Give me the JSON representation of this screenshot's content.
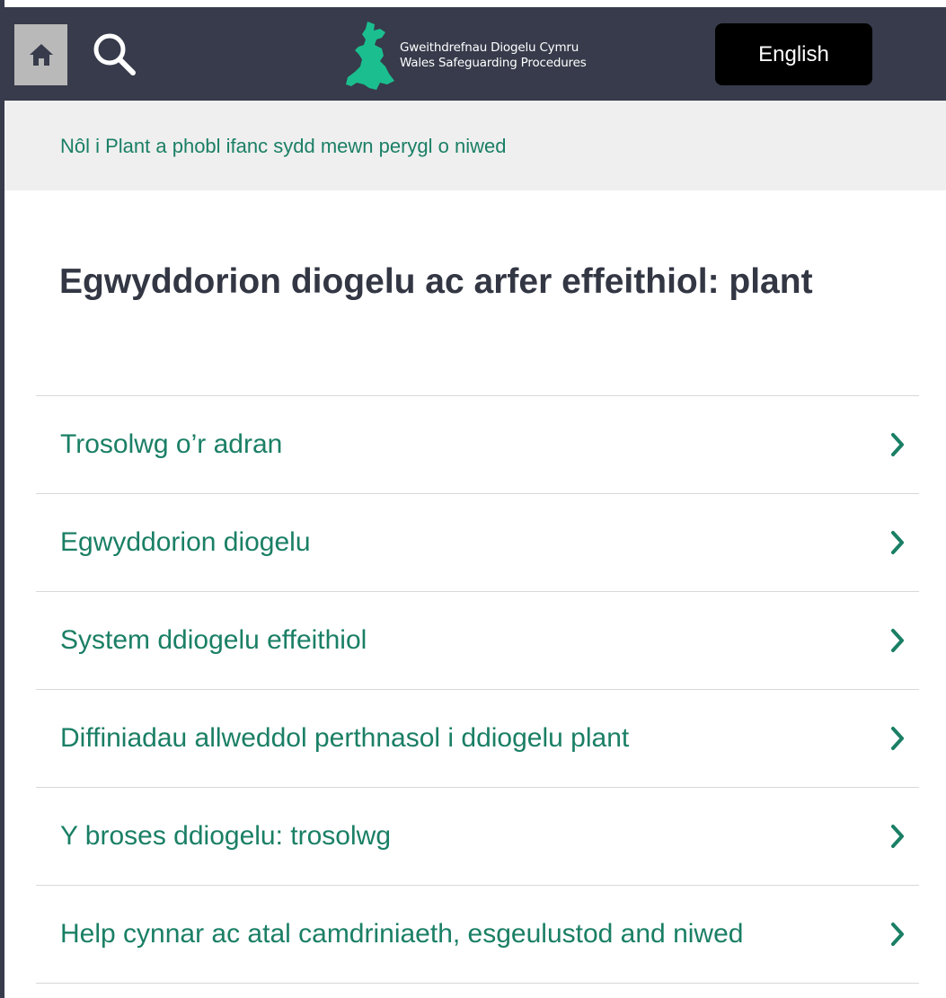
{
  "header": {
    "logo_line1": "Gweithdrefnau Diogelu Cymru",
    "logo_line2": "Wales Safeguarding Procedures",
    "language_button": "English",
    "background_color": "#373b4b",
    "logo_color": "#1bbf8f"
  },
  "breadcrumb": {
    "back_link": "Nôl i Plant a phobl ifanc sydd mewn perygl o niwed"
  },
  "page": {
    "title": "Egwyddorion diogelu ac arfer effeithiol: plant"
  },
  "nav_items": [
    {
      "label": "Trosolwg o’r adran"
    },
    {
      "label": "Egwyddorion diogelu"
    },
    {
      "label": "System ddiogelu effeithiol"
    },
    {
      "label": "Diffiniadau allweddol perthnasol i ddiogelu plant"
    },
    {
      "label": "Y broses ddiogelu: trosolwg"
    },
    {
      "label": "Help cynnar ac atal camdriniaeth, esgeulustod and niwed"
    }
  ],
  "colors": {
    "link": "#1a7f65",
    "title": "#333744",
    "breadcrumb_bg": "#efefef"
  }
}
